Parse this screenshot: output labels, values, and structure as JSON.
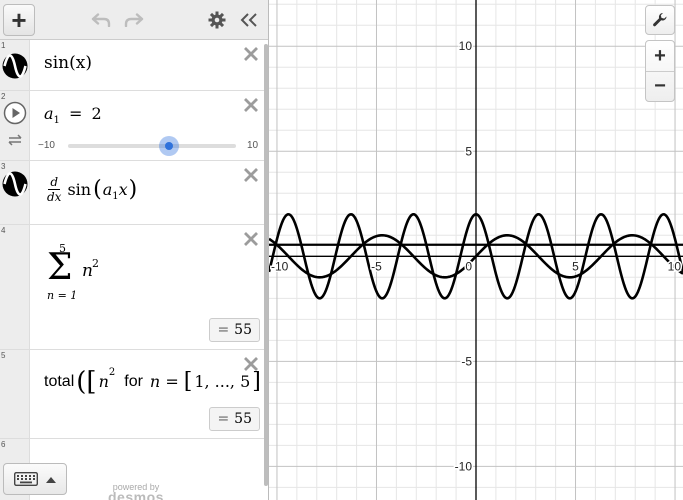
{
  "toolbar": {
    "add_label": "+"
  },
  "expressions": [
    {
      "index": "1",
      "text": "sin(x)"
    },
    {
      "index": "2",
      "var": "a",
      "sub": "1",
      "eq": "=",
      "value": "2",
      "slider_min": "−10",
      "slider_max": "10",
      "slider_fraction": 0.6
    },
    {
      "index": "3",
      "d": "d",
      "dx": "dx",
      "fn": "sin",
      "var": "a",
      "sub": "1",
      "x": "x"
    },
    {
      "index": "4",
      "upper": "5",
      "lower": "n = 1",
      "term": "n",
      "power": "2",
      "result": "55"
    },
    {
      "index": "5",
      "fn": "total",
      "term": "n",
      "power": "2",
      "for": "for",
      "n_eq": "n =",
      "list": "1, ..., 5",
      "result": "55"
    },
    {
      "index": "6"
    }
  ],
  "footer": {
    "powered": "powered by",
    "brand": "desmos"
  },
  "graph": {
    "x_ticks": [
      "-10",
      "-5",
      "0",
      "5",
      "10"
    ],
    "y_ticks": [
      "10",
      "5",
      "-5",
      "-10"
    ],
    "zoom_in": "+",
    "zoom_out": "−"
  },
  "chart_data": {
    "type": "line",
    "xlim": [
      -10.4,
      10.4
    ],
    "ylim": [
      -11.6,
      12.2
    ],
    "grid": true,
    "series": [
      {
        "formula": "sin(x)",
        "amplitude": 1,
        "frequency": 1,
        "color": "#000000"
      },
      {
        "formula": "d/dx sin(a1 x), a1 = 2",
        "amplitude": 2,
        "frequency": 2,
        "color": "#000000"
      }
    ],
    "hlines": [
      {
        "y": 0.55,
        "color": "#000000"
      }
    ]
  },
  "colors": {
    "curve": "#000000",
    "slider_thumb": "#2f72dc",
    "grid_minor": "#e6e6e6",
    "grid_major": "#c2c2c2"
  }
}
